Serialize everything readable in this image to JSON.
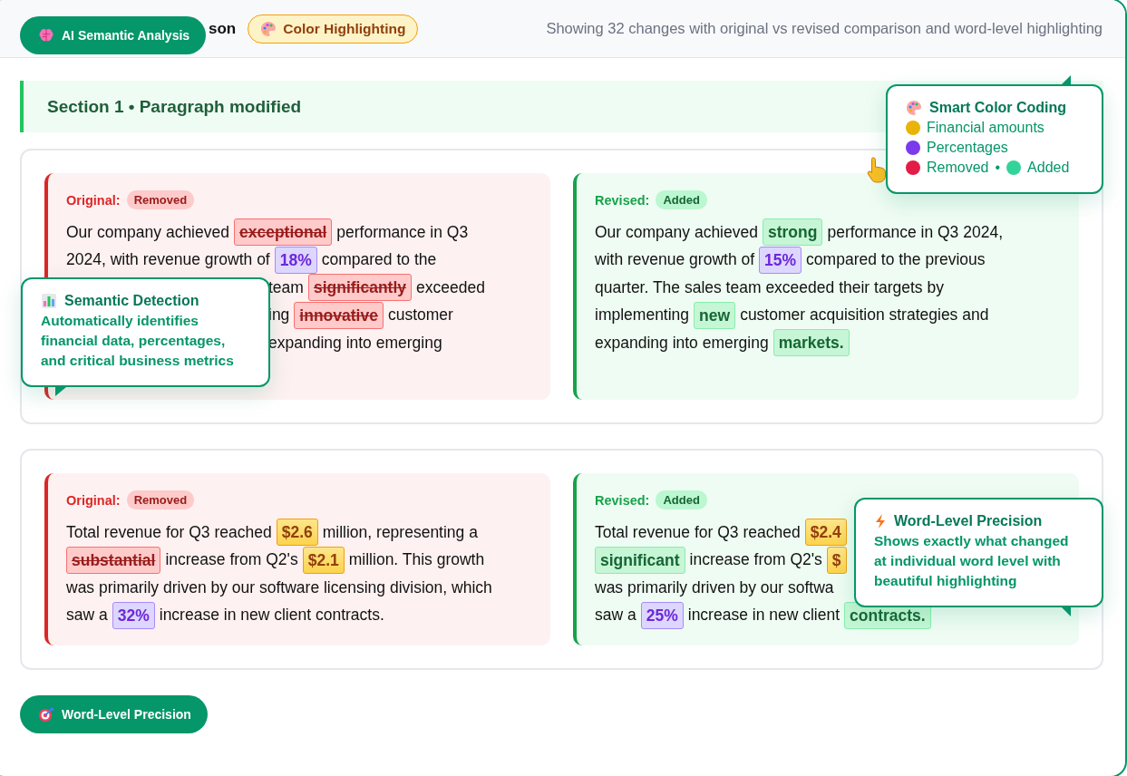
{
  "header": {
    "title": "son",
    "tag": {
      "label": "Color Highlighting"
    },
    "summary": "Showing 32 changes with original vs revised comparison and word-level highlighting"
  },
  "feature_badges": [
    {
      "label": "AI Semantic Analysis"
    },
    {
      "label": "Word-Level Precision"
    }
  ],
  "sections": [
    {
      "title": "Section 1 • Paragraph modified",
      "panels": [
        {
          "kind": "original",
          "label": "Original:",
          "badge": "Removed",
          "lines": [
            {
              "partial": false,
              "segments": [
                {
                  "text": "Our company achieved",
                  "kind": "plain"
                },
                {
                  "text": "exceptional",
                  "kind": "removed"
                },
                {
                  "text": "performance in Q3",
                  "kind": "plain"
                }
              ]
            },
            {
              "partial": false,
              "segments": [
                {
                  "text": "2024, with revenue growth of",
                  "kind": "plain"
                },
                {
                  "text": "18%",
                  "kind": "percent"
                },
                {
                  "text": "compared to the",
                  "kind": "plain"
                }
              ]
            },
            {
              "partial": true,
              "segments": [
                {
                  "text": "team",
                  "kind": "plain"
                },
                {
                  "text": "significantly",
                  "kind": "removed"
                },
                {
                  "text": "exceeded",
                  "kind": "plain"
                }
              ]
            },
            {
              "partial": true,
              "segments": [
                {
                  "text": "ing",
                  "kind": "plain"
                },
                {
                  "text": "innovative",
                  "kind": "removed"
                },
                {
                  "text": "customer",
                  "kind": "plain"
                }
              ]
            },
            {
              "partial": true,
              "segments": [
                {
                  "text": "expanding into emerging",
                  "kind": "plain"
                }
              ]
            }
          ]
        },
        {
          "kind": "revised",
          "label": "Revised:",
          "badge": "Added",
          "lines": [
            {
              "partial": false,
              "segments": [
                {
                  "text": "Our company achieved",
                  "kind": "plain"
                },
                {
                  "text": "strong",
                  "kind": "added"
                },
                {
                  "text": "performance in Q3 2024,",
                  "kind": "plain"
                }
              ]
            },
            {
              "partial": false,
              "segments": [
                {
                  "text": "with revenue growth of",
                  "kind": "plain"
                },
                {
                  "text": "15%",
                  "kind": "percent"
                },
                {
                  "text": "compared to the previous",
                  "kind": "plain"
                }
              ]
            },
            {
              "partial": false,
              "segments": [
                {
                  "text": "quarter. The sales team exceeded their targets by",
                  "kind": "plain"
                }
              ]
            },
            {
              "partial": false,
              "segments": [
                {
                  "text": "implementing",
                  "kind": "plain"
                },
                {
                  "text": "new",
                  "kind": "added"
                },
                {
                  "text": "customer acquisition strategies and",
                  "kind": "plain"
                }
              ]
            },
            {
              "partial": false,
              "segments": [
                {
                  "text": "expanding into emerging",
                  "kind": "plain"
                },
                {
                  "text": "markets.",
                  "kind": "added"
                }
              ]
            }
          ]
        }
      ]
    },
    {
      "panels": [
        {
          "kind": "original",
          "label": "Original:",
          "badge": "Removed",
          "lines": [
            {
              "partial": false,
              "segments": [
                {
                  "text": "Total revenue for Q3 reached",
                  "kind": "plain"
                },
                {
                  "text": "$2.6",
                  "kind": "amount"
                },
                {
                  "text": "million, representing a",
                  "kind": "plain"
                }
              ]
            },
            {
              "partial": false,
              "segments": [
                {
                  "text": "substantial",
                  "kind": "removed"
                },
                {
                  "text": "increase from Q2's",
                  "kind": "plain"
                },
                {
                  "text": "$2.1",
                  "kind": "amount"
                },
                {
                  "text": "million. This growth",
                  "kind": "plain"
                }
              ]
            },
            {
              "partial": false,
              "segments": [
                {
                  "text": "was primarily driven by our software licensing division, which",
                  "kind": "plain"
                }
              ]
            },
            {
              "partial": false,
              "segments": [
                {
                  "text": "saw a",
                  "kind": "plain"
                },
                {
                  "text": "32%",
                  "kind": "percent"
                },
                {
                  "text": "increase in new client contracts.",
                  "kind": "plain"
                }
              ]
            }
          ]
        },
        {
          "kind": "revised",
          "label": "Revised:",
          "badge": "Added",
          "lines": [
            {
              "partial": false,
              "segments": [
                {
                  "text": "Total revenue for Q3 reached",
                  "kind": "plain"
                },
                {
                  "text": "$2.4",
                  "kind": "amount"
                }
              ]
            },
            {
              "partial": false,
              "segments": [
                {
                  "text": "significant",
                  "kind": "added"
                },
                {
                  "text": "increase from Q2's",
                  "kind": "plain"
                },
                {
                  "text": "$",
                  "kind": "amount"
                }
              ]
            },
            {
              "partial": false,
              "segments": [
                {
                  "text": "was primarily driven by our softwa",
                  "kind": "plain"
                }
              ]
            },
            {
              "partial": false,
              "segments": [
                {
                  "text": "saw a",
                  "kind": "plain"
                },
                {
                  "text": "25%",
                  "kind": "percent"
                },
                {
                  "text": "increase in new client",
                  "kind": "plain"
                },
                {
                  "text": "contracts.",
                  "kind": "added"
                }
              ]
            }
          ]
        }
      ]
    }
  ],
  "callouts": [
    {
      "title": "Smart Color Coding",
      "legend": [
        {
          "items": [
            {
              "label": "Financial amounts",
              "color": "#eab308"
            }
          ]
        },
        {
          "items": [
            {
              "label": "Percentages",
              "color": "#7c3aed"
            }
          ]
        },
        {
          "items": [
            {
              "label": "Removed",
              "color": "#e11d48"
            },
            {
              "label": "Added",
              "color": "#34d399"
            }
          ],
          "separator": "•"
        }
      ]
    },
    {
      "title": "Semantic Detection",
      "text": "Automatically identifies financial data, percentages, and critical business metrics"
    },
    {
      "title": "Word-Level Precision",
      "text": "Shows exactly what changed at individual word level with beautiful highlighting"
    }
  ]
}
